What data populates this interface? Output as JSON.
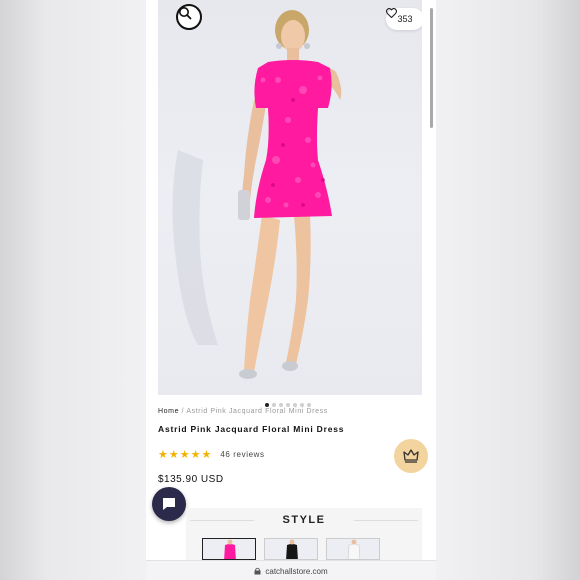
{
  "header": {
    "search_icon": "search-icon",
    "like_icon": "heart-icon",
    "like_count": "353"
  },
  "gallery": {
    "total_images": 7,
    "active_index": 0
  },
  "breadcrumb": {
    "home": "Home",
    "separator": "/",
    "current": "Astrid Pink Jacquard Floral Mini Dress"
  },
  "product": {
    "title": "Astrid Pink Jacquard Floral Mini Dress",
    "rating": 5,
    "reviews": "46 reviews",
    "price": "$135.90 USD",
    "dress_color": "#ff1aa0"
  },
  "style_section": {
    "title": "STYLE",
    "swatches": [
      {
        "name": "pink",
        "color": "#ff1aa0",
        "selected": true
      },
      {
        "name": "black",
        "color": "#151515",
        "selected": false
      },
      {
        "name": "white",
        "color": "#f0f0f0",
        "selected": false
      }
    ]
  },
  "browser": {
    "url": "catchallstore.com",
    "lock_icon": "lock-icon"
  },
  "colors": {
    "accent_star": "#f2b200",
    "crown_button": "#f3d39e",
    "chat_button": "#2c2a4a"
  }
}
